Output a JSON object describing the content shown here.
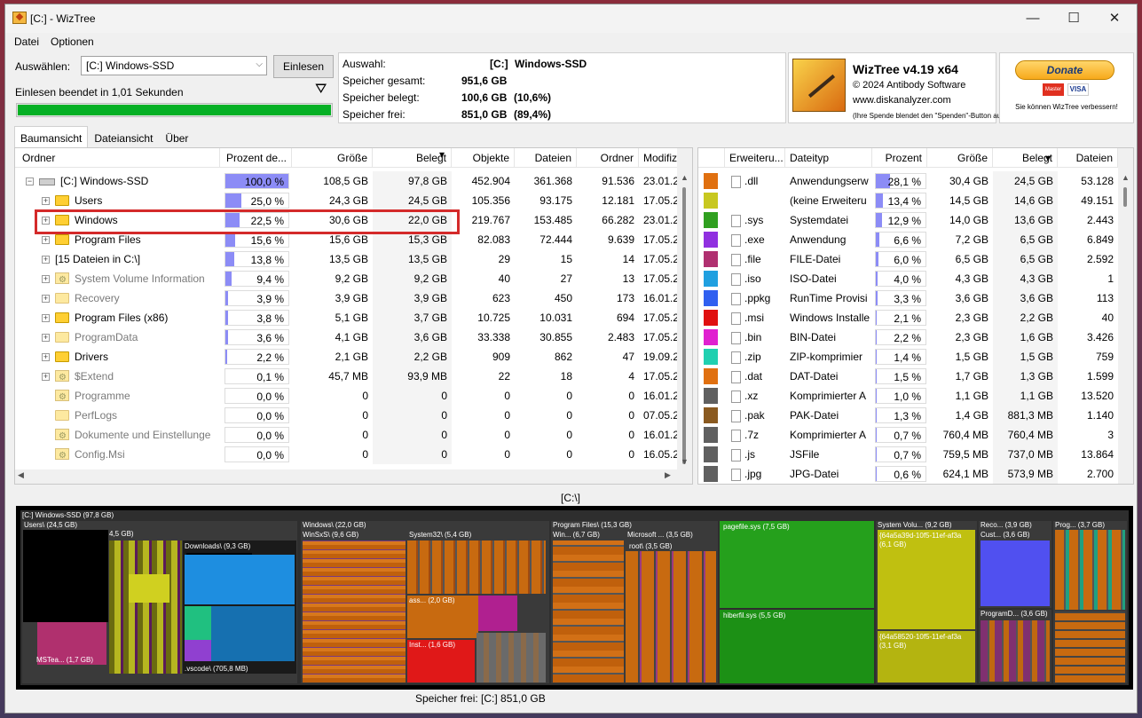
{
  "window": {
    "title": "[C:]  - WizTree",
    "min": "—",
    "max": "☐",
    "close": "✕"
  },
  "menu": [
    "Datei",
    "Optionen"
  ],
  "scan": {
    "select_label": "Auswählen:",
    "drive_value": "[C:] Windows-SSD",
    "scan_button": "Einlesen",
    "status": "Einlesen beendet in 1,01 Sekunden",
    "progress": 1.0
  },
  "info": {
    "selection_label": "Auswahl:",
    "selection_drive": "[C:]",
    "selection_name": "Windows-SSD",
    "total_label": "Speicher gesamt:",
    "total_value": "951,6 GB",
    "used_label": "Speicher belegt:",
    "used_value": "100,6 GB",
    "used_pct": "(10,6%)",
    "free_label": "Speicher frei:",
    "free_value": "851,0 GB",
    "free_pct": "(89,4%)"
  },
  "about": {
    "product": "WizTree v4.19 x64",
    "copyright": "© 2024 Antibody Software",
    "website": "www.diskanalyzer.com",
    "note": "(Ihre Spende blendet den \"Spenden\"-Button aus)"
  },
  "donate": {
    "label": "Donate",
    "card1": "Master",
    "card2": "VISA",
    "subtitle": "Sie können WizTree verbessern!"
  },
  "tabs": [
    "Baumansicht",
    "Dateiansicht",
    "Über"
  ],
  "tree": {
    "columns": [
      "Ordner",
      "Prozent de...",
      "Größe",
      "Belegt",
      "Objekte",
      "Dateien",
      "Ordner",
      "Modifiziert"
    ],
    "rows": [
      {
        "name": "[C:] Windows-SSD",
        "pct": "100,0 %",
        "pct_val": 100,
        "size": "108,5 GB",
        "alloc": "97,8 GB",
        "objects": "452.904",
        "files": "361.368",
        "folders": "91.536",
        "mod": "23.01.2"
      },
      {
        "name": "Users",
        "pct": "25,0 %",
        "pct_val": 25,
        "size": "24,3 GB",
        "alloc": "24,5 GB",
        "objects": "105.356",
        "files": "93.175",
        "folders": "12.181",
        "mod": "17.05.2"
      },
      {
        "name": "Windows",
        "pct": "22,5 %",
        "pct_val": 22.5,
        "size": "30,6 GB",
        "alloc": "22,0 GB",
        "objects": "219.767",
        "files": "153.485",
        "folders": "66.282",
        "mod": "23.01.2"
      },
      {
        "name": "Program Files",
        "pct": "15,6 %",
        "pct_val": 15.6,
        "size": "15,6 GB",
        "alloc": "15,3 GB",
        "objects": "82.083",
        "files": "72.444",
        "folders": "9.639",
        "mod": "17.05.2"
      },
      {
        "name": "[15 Dateien in C:\\]",
        "pct": "13,8 %",
        "pct_val": 13.8,
        "size": "13,5 GB",
        "alloc": "13,5 GB",
        "objects": "29",
        "files": "15",
        "folders": "14",
        "mod": "17.05.2"
      },
      {
        "name": "System Volume Information",
        "pct": "9,4 %",
        "pct_val": 9.4,
        "size": "9,2 GB",
        "alloc": "9,2 GB",
        "objects": "40",
        "files": "27",
        "folders": "13",
        "mod": "17.05.2"
      },
      {
        "name": "Recovery",
        "pct": "3,9 %",
        "pct_val": 3.9,
        "size": "3,9 GB",
        "alloc": "3,9 GB",
        "objects": "623",
        "files": "450",
        "folders": "173",
        "mod": "16.01.2"
      },
      {
        "name": "Program Files (x86)",
        "pct": "3,8 %",
        "pct_val": 3.8,
        "size": "5,1 GB",
        "alloc": "3,7 GB",
        "objects": "10.725",
        "files": "10.031",
        "folders": "694",
        "mod": "17.05.2"
      },
      {
        "name": "ProgramData",
        "pct": "3,6 %",
        "pct_val": 3.6,
        "size": "4,1 GB",
        "alloc": "3,6 GB",
        "objects": "33.338",
        "files": "30.855",
        "folders": "2.483",
        "mod": "17.05.2"
      },
      {
        "name": "Drivers",
        "pct": "2,2 %",
        "pct_val": 2.2,
        "size": "2,1 GB",
        "alloc": "2,2 GB",
        "objects": "909",
        "files": "862",
        "folders": "47",
        "mod": "19.09.2"
      },
      {
        "name": "$Extend",
        "pct": "0,1 %",
        "pct_val": 0.1,
        "size": "45,7 MB",
        "alloc": "93,9 MB",
        "objects": "22",
        "files": "18",
        "folders": "4",
        "mod": "17.05.2"
      },
      {
        "name": "Programme",
        "pct": "0,0 %",
        "pct_val": 0,
        "size": "0",
        "alloc": "0",
        "objects": "0",
        "files": "0",
        "folders": "0",
        "mod": "16.01.2"
      },
      {
        "name": "PerfLogs",
        "pct": "0,0 %",
        "pct_val": 0,
        "size": "0",
        "alloc": "0",
        "objects": "0",
        "files": "0",
        "folders": "0",
        "mod": "07.05.2"
      },
      {
        "name": "Dokumente und Einstellunge",
        "pct": "0,0 %",
        "pct_val": 0,
        "size": "0",
        "alloc": "0",
        "objects": "0",
        "files": "0",
        "folders": "0",
        "mod": "16.01.2"
      },
      {
        "name": "Config.Msi",
        "pct": "0,0 %",
        "pct_val": 0,
        "size": "0",
        "alloc": "0",
        "objects": "0",
        "files": "0",
        "folders": "0",
        "mod": "16.05.2"
      }
    ]
  },
  "types": {
    "columns": [
      "Erweiteru...",
      "Dateityp",
      "Prozent",
      "Größe",
      "Belegt",
      "Dateien"
    ],
    "rows": [
      {
        "color": "#e07010",
        "ext": ".dll",
        "type": "Anwendungserw",
        "pct": "28,1 %",
        "pct_val": 28.1,
        "size": "30,4 GB",
        "alloc": "24,5 GB",
        "files": "53.128"
      },
      {
        "color": "#c8c820",
        "ext": "",
        "type": "(keine Erweiteru",
        "pct": "13,4 %",
        "pct_val": 13.4,
        "size": "14,5 GB",
        "alloc": "14,6 GB",
        "files": "49.151"
      },
      {
        "color": "#30a020",
        "ext": ".sys",
        "type": "Systemdatei",
        "pct": "12,9 %",
        "pct_val": 12.9,
        "size": "14,0 GB",
        "alloc": "13,6 GB",
        "files": "2.443"
      },
      {
        "color": "#9030e0",
        "ext": ".exe",
        "type": "Anwendung",
        "pct": "6,6 %",
        "pct_val": 6.6,
        "size": "7,2 GB",
        "alloc": "6,5 GB",
        "files": "6.849"
      },
      {
        "color": "#b03070",
        "ext": ".file",
        "type": "FILE-Datei",
        "pct": "6,0 %",
        "pct_val": 6.0,
        "size": "6,5 GB",
        "alloc": "6,5 GB",
        "files": "2.592"
      },
      {
        "color": "#20a0e0",
        "ext": ".iso",
        "type": "ISO-Datei",
        "pct": "4,0 %",
        "pct_val": 4.0,
        "size": "4,3 GB",
        "alloc": "4,3 GB",
        "files": "1"
      },
      {
        "color": "#3060f0",
        "ext": ".ppkg",
        "type": "RunTime Provisi",
        "pct": "3,3 %",
        "pct_val": 3.3,
        "size": "3,6 GB",
        "alloc": "3,6 GB",
        "files": "113"
      },
      {
        "color": "#e01010",
        "ext": ".msi",
        "type": "Windows Installe",
        "pct": "2,1 %",
        "pct_val": 2.1,
        "size": "2,3 GB",
        "alloc": "2,2 GB",
        "files": "40"
      },
      {
        "color": "#e020d0",
        "ext": ".bin",
        "type": "BIN-Datei",
        "pct": "2,2 %",
        "pct_val": 2.2,
        "size": "2,3 GB",
        "alloc": "1,6 GB",
        "files": "3.426"
      },
      {
        "color": "#20d0b0",
        "ext": ".zip",
        "type": "ZIP-komprimier",
        "pct": "1,4 %",
        "pct_val": 1.4,
        "size": "1,5 GB",
        "alloc": "1,5 GB",
        "files": "759"
      },
      {
        "color": "#e07010",
        "ext": ".dat",
        "type": "DAT-Datei",
        "pct": "1,5 %",
        "pct_val": 1.5,
        "size": "1,7 GB",
        "alloc": "1,3 GB",
        "files": "1.599"
      },
      {
        "color": "#606060",
        "ext": ".xz",
        "type": "Komprimierter A",
        "pct": "1,0 %",
        "pct_val": 1.0,
        "size": "1,1 GB",
        "alloc": "1,1 GB",
        "files": "13.520"
      },
      {
        "color": "#8a5a20",
        "ext": ".pak",
        "type": "PAK-Datei",
        "pct": "1,3 %",
        "pct_val": 1.3,
        "size": "1,4 GB",
        "alloc": "881,3 MB",
        "files": "1.140"
      },
      {
        "color": "#606060",
        "ext": ".7z",
        "type": "Komprimierter A",
        "pct": "0,7 %",
        "pct_val": 0.7,
        "size": "760,4 MB",
        "alloc": "760,4 MB",
        "files": "3"
      },
      {
        "color": "#606060",
        "ext": ".js",
        "type": "JSFile",
        "pct": "0,7 %",
        "pct_val": 0.7,
        "size": "759,5 MB",
        "alloc": "737,0 MB",
        "files": "13.864"
      },
      {
        "color": "#606060",
        "ext": ".jpg",
        "type": "JPG-Datei",
        "pct": "0,6 %",
        "pct_val": 0.6,
        "size": "624,1 MB",
        "alloc": "573,9 MB",
        "files": "2.700"
      }
    ]
  },
  "path_label": "[C:\\]",
  "treemap": {
    "root": "[C:] Windows-SSD (97,8 GB)",
    "users": "Users\\ (24,5 GB)",
    "users_sub": "4,5 GB)",
    "downloads": "Downloads\\ (9,3 GB)",
    "msteams": "MSTea... (1,7 GB)",
    "vscode": ".vscode\\ (705,8 MB)",
    "windows": "Windows\\ (22,0 GB)",
    "winsxs": "WinSxS\\ (9,6 GB)",
    "system32": "System32\\ (5,4 GB)",
    "ass": "ass... (2,0 GB)",
    "inst": "Inst... (1,6 GB)",
    "progfiles": "Program Files\\ (15,3 GB)",
    "win_pf": "Win... (6,7 GB)",
    "ms": "Microsoft ... (3,5 GB)",
    "root3": "root\\ (3,5 GB)",
    "pagefile": "pagefile.sys (7,5 GB)",
    "hiberfil": "hiberfil.sys (5,5 GB)",
    "sysvol": "System Volu... (9,2 GB)",
    "guid1": "{64a5a39d-10f5-11ef-af3a",
    "guid1_size": "(6,1 GB)",
    "guid2": "{64a58520-10f5-11ef-af3a",
    "guid2_size": "(3,1 GB)",
    "reco": "Reco... (3,9 GB)",
    "cust": "Cust... (3,6 GB)",
    "prog": "Prog... (3,7 GB)",
    "progdata": "ProgramD... (3,6 GB)"
  },
  "status_free": "Speicher frei: [C:] 851,0 GB"
}
